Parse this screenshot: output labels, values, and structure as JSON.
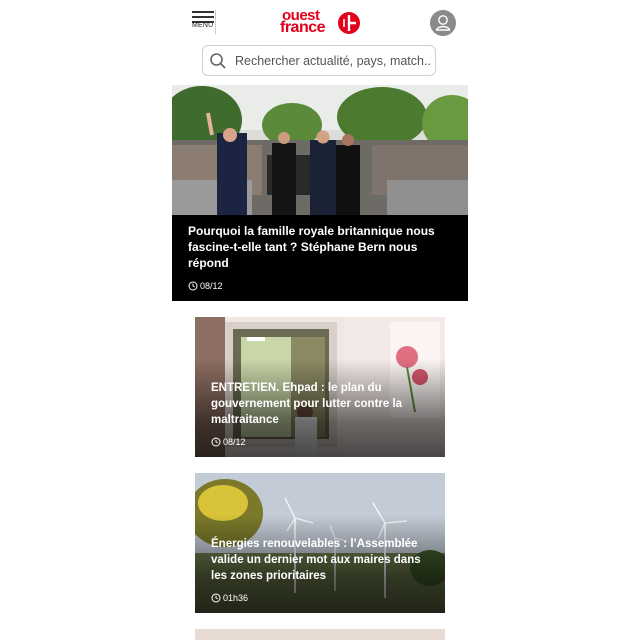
{
  "header": {
    "menu_label": "MENU",
    "logo_line1": "ouest",
    "logo_line2": "france"
  },
  "search": {
    "placeholder": "Rechercher actualité, pays, match..."
  },
  "articles": [
    {
      "title": "Pourquoi la famille royale britannique nous fascine-t-elle tant ? Stéphane Bern nous répond",
      "time": "08/12"
    },
    {
      "title": "ENTRETIEN. Ehpad : le plan du gouvernement pour lutter contre la maltraitance",
      "time": "08/12"
    },
    {
      "title": "Énergies renouvelables : l’Assemblée valide un dernier mot aux maires dans les zones prioritaires",
      "time": "01h36"
    }
  ],
  "colors": {
    "brand": "#e2001a",
    "avatar": "#8a8a8a"
  }
}
